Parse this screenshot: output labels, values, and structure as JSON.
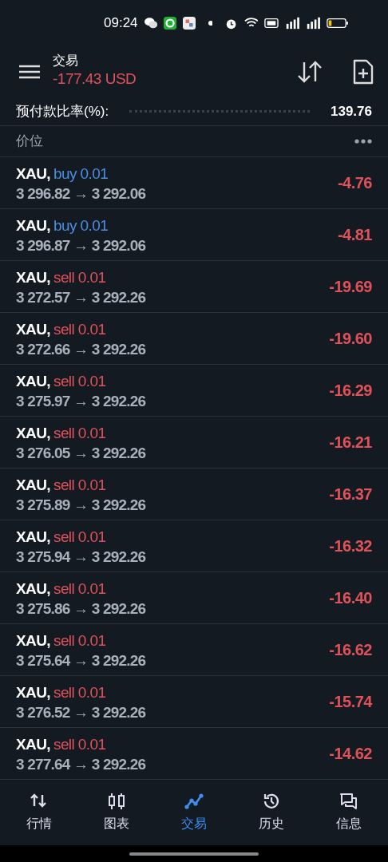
{
  "status_bar": {
    "time": "09:24"
  },
  "header": {
    "title": "交易",
    "balance": "-177.43 USD"
  },
  "summary": {
    "label": "预付款比率(%):",
    "value": "139.76"
  },
  "section": {
    "title": "价位"
  },
  "positions": [
    {
      "symbol": "XAU,",
      "kind": "buy",
      "order": "buy 0.01",
      "prices": "3 296.82 → 3 292.06",
      "profit": "-4.76"
    },
    {
      "symbol": "XAU,",
      "kind": "buy",
      "order": "buy 0.01",
      "prices": "3 296.87 → 3 292.06",
      "profit": "-4.81"
    },
    {
      "symbol": "XAU,",
      "kind": "sell",
      "order": "sell 0.01",
      "prices": "3 272.57 → 3 292.26",
      "profit": "-19.69"
    },
    {
      "symbol": "XAU,",
      "kind": "sell",
      "order": "sell 0.01",
      "prices": "3 272.66 → 3 292.26",
      "profit": "-19.60"
    },
    {
      "symbol": "XAU,",
      "kind": "sell",
      "order": "sell 0.01",
      "prices": "3 275.97 → 3 292.26",
      "profit": "-16.29"
    },
    {
      "symbol": "XAU,",
      "kind": "sell",
      "order": "sell 0.01",
      "prices": "3 276.05 → 3 292.26",
      "profit": "-16.21"
    },
    {
      "symbol": "XAU,",
      "kind": "sell",
      "order": "sell 0.01",
      "prices": "3 275.89 → 3 292.26",
      "profit": "-16.37"
    },
    {
      "symbol": "XAU,",
      "kind": "sell",
      "order": "sell 0.01",
      "prices": "3 275.94 → 3 292.26",
      "profit": "-16.32"
    },
    {
      "symbol": "XAU,",
      "kind": "sell",
      "order": "sell 0.01",
      "prices": "3 275.86 → 3 292.26",
      "profit": "-16.40"
    },
    {
      "symbol": "XAU,",
      "kind": "sell",
      "order": "sell 0.01",
      "prices": "3 275.64 → 3 292.26",
      "profit": "-16.62"
    },
    {
      "symbol": "XAU,",
      "kind": "sell",
      "order": "sell 0.01",
      "prices": "3 276.52 → 3 292.26",
      "profit": "-15.74"
    },
    {
      "symbol": "XAU,",
      "kind": "sell",
      "order": "sell 0.01",
      "prices": "3 277.64 → 3 292.26",
      "profit": "-14.62"
    }
  ],
  "bottom_nav": [
    {
      "label": "行情",
      "kind": "quotes",
      "selected": false
    },
    {
      "label": "图表",
      "kind": "chart",
      "selected": false
    },
    {
      "label": "交易",
      "kind": "trade",
      "selected": true
    },
    {
      "label": "历史",
      "kind": "history",
      "selected": false
    },
    {
      "label": "信息",
      "kind": "messages",
      "selected": false
    }
  ]
}
